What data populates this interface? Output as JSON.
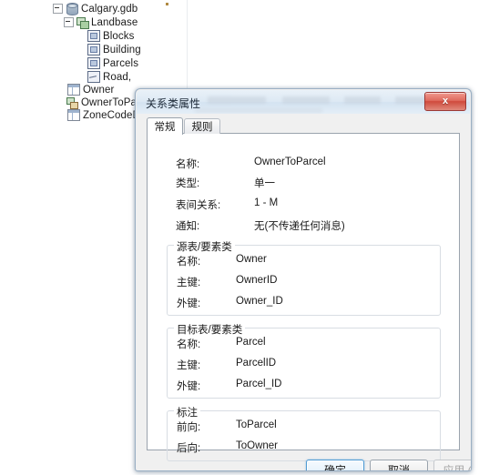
{
  "catalog": {
    "items": [
      {
        "label": "Calgary.gdb",
        "icon": "geodatabase-icon",
        "indent": 0,
        "expander": "collapse"
      },
      {
        "label": "Landbase",
        "icon": "feature-dataset-icon",
        "indent": 1,
        "expander": "collapse"
      },
      {
        "label": "Blocks",
        "icon": "polygon-feature-class-icon",
        "indent": 2,
        "expander": "none"
      },
      {
        "label": "Building",
        "icon": "polygon-feature-class-icon",
        "indent": 2,
        "expander": "none"
      },
      {
        "label": "Parcels",
        "icon": "polygon-feature-class-icon",
        "indent": 2,
        "expander": "none"
      },
      {
        "label": "Road,",
        "icon": "line-feature-class-icon",
        "indent": 2,
        "expander": "none"
      },
      {
        "label": "Owner",
        "icon": "table-icon",
        "indent": 1,
        "expander": "none"
      },
      {
        "label": "OwnerToParce",
        "icon": "relationship-class-icon",
        "indent": 1,
        "expander": "none"
      },
      {
        "label": "ZoneCodeDesc",
        "icon": "table-icon",
        "indent": 1,
        "expander": "none"
      }
    ]
  },
  "dialog": {
    "title": "关系类属性",
    "close_label": "x",
    "tabs": [
      {
        "label": "常规",
        "active": true
      },
      {
        "label": "规则",
        "active": false
      }
    ],
    "general": {
      "rows": [
        {
          "label": "名称:",
          "value": "OwnerToParcel"
        },
        {
          "label": "类型:",
          "value": "单一"
        },
        {
          "label": "表间关系:",
          "value": "1 - M"
        },
        {
          "label": "通知:",
          "value": "无(不传递任何消息)"
        }
      ]
    },
    "origin_group": {
      "title": "源表/要素类",
      "rows": [
        {
          "label": "名称:",
          "value": "Owner"
        },
        {
          "label": "主键:",
          "value": "OwnerID"
        },
        {
          "label": "外键:",
          "value": "Owner_ID"
        }
      ]
    },
    "destination_group": {
      "title": "目标表/要素类",
      "rows": [
        {
          "label": "名称:",
          "value": "Parcel"
        },
        {
          "label": "主键:",
          "value": "ParcelID"
        },
        {
          "label": "外键:",
          "value": "Parcel_ID"
        }
      ]
    },
    "labels_group": {
      "title": "标注",
      "rows": [
        {
          "label": "前向:",
          "value": "ToParcel"
        },
        {
          "label": "后向:",
          "value": "ToOwner"
        }
      ]
    },
    "buttons": [
      {
        "label": "确定",
        "style": "default"
      },
      {
        "label": "取消",
        "style": "normal"
      },
      {
        "label": "应用 (A)",
        "style": "disabled"
      }
    ]
  },
  "colors": {
    "accent": "#4f9bd4",
    "close_red": "#cf4a3c",
    "dialog_face": "#f0f0f0",
    "panel_white": "#ffffff"
  }
}
